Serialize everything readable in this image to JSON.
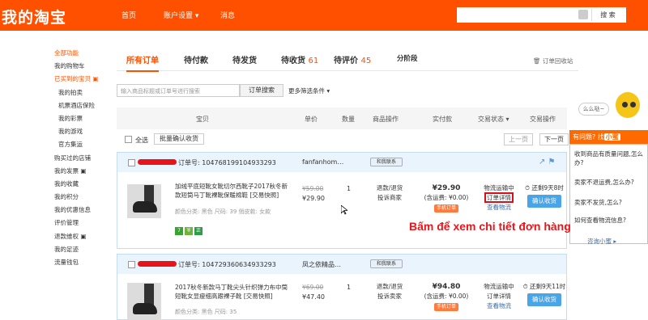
{
  "topbar": {
    "logo": "我的淘宝",
    "nav": [
      "首页",
      "账户设置 ▾",
      "消息"
    ],
    "search_btn": "搜 索"
  },
  "sidebar": {
    "items": [
      {
        "label": "全部功能",
        "style": "hl"
      },
      {
        "label": "我的购物车",
        "style": ""
      },
      {
        "label": "已买到的宝贝 ▣",
        "style": "hl"
      },
      {
        "label": "我的拍卖",
        "style": "sub"
      },
      {
        "label": "机票酒店保险",
        "style": "sub"
      },
      {
        "label": "我的彩票",
        "style": "sub"
      },
      {
        "label": "我的游戏",
        "style": "sub"
      },
      {
        "label": "官方集运",
        "style": "sub"
      },
      {
        "label": "购买过的店铺",
        "style": ""
      },
      {
        "label": "我的发票 ▣",
        "style": ""
      },
      {
        "label": "我的收藏",
        "style": ""
      },
      {
        "label": "我的积分",
        "style": ""
      },
      {
        "label": "我的优惠信息",
        "style": ""
      },
      {
        "label": "评价管理",
        "style": ""
      },
      {
        "label": "退款维权 ▣",
        "style": ""
      },
      {
        "label": "我的足迹",
        "style": ""
      },
      {
        "label": "流量钱包",
        "style": ""
      }
    ]
  },
  "tabs": [
    {
      "label": "所有订单",
      "count": ""
    },
    {
      "label": "待付款",
      "count": ""
    },
    {
      "label": "待发货",
      "count": ""
    },
    {
      "label": "待收货",
      "count": "61"
    },
    {
      "label": "待评价",
      "count": "45"
    },
    {
      "label": "分阶段",
      "count": ""
    }
  ],
  "recycle": "🗑 订单回收站",
  "filter": {
    "placeholder": "输入商品标题或订单号进行搜索",
    "search_btn": "订单搜索",
    "more": "更多筛选条件 ▾"
  },
  "table_headers": [
    "宝贝",
    "单价",
    "数量",
    "商品操作",
    "实付款",
    "交易状态 ▾",
    "交易操作"
  ],
  "bar": {
    "select_all": "全选",
    "batch": "批量确认收货",
    "prev": "上一页",
    "next": "下一页"
  },
  "orders": [
    {
      "order_no": "订单号: 104768199104933293",
      "shop": "fanfanhom…",
      "contact": "和我联系",
      "title": "加绒平底短靴女靴切尔西靴子2017秋冬新款短筒马丁靴裸靴保暖棉鞋 [交易快照]",
      "attrs": "颜色分类: 黑色  尺码: 39  俏皮款: 女款",
      "old_price": "¥59.00",
      "price": "¥29.90",
      "qty": "1",
      "ops": [
        "退款/退货",
        "投诉商家"
      ],
      "total": "¥29.90",
      "shipping": "(含运费: ¥0.00)",
      "mobile": "手机订单",
      "status": "物流运输中",
      "detail": "订单详情",
      "logistics": "查看物流",
      "remaining": "⏱ 还剩9天8时",
      "confirm": "确认收货"
    },
    {
      "order_no": "订单号: 104729360634933293",
      "shop": "凤之依精品…",
      "contact": "和我联系",
      "title": "2017秋冬新款马丁靴尖头针织弹力布中筒短靴女显瘦细高跟裸子靴 [交易快照]",
      "attrs": "颜色分类: 黑色  尺码: 35",
      "old_price": "¥69.00",
      "price": "¥47.40",
      "qty": "1",
      "ops": [
        "退款/退货",
        "投诉卖家"
      ],
      "total": "¥94.80",
      "shipping": "(含运费: ¥0.00)",
      "mobile": "手机订单",
      "status": "物流运输中",
      "detail": "订单详情",
      "logistics": "查看物流",
      "remaining": "⏱ 还剩9天11时",
      "confirm": "确认收货"
    }
  ],
  "help": {
    "ask": "么么哒~",
    "bar_prefix": "有问题? 找",
    "bar_name": "小蜜",
    "questions": [
      "收到商品有质量问题,怎么办?",
      "卖家不退运费,怎么办?",
      "卖家不发货,怎么?",
      "如何查看物流信息?"
    ],
    "more": "咨询小蜜 ▸"
  },
  "callout": "Bấm để xem chi tiết đơn hàng",
  "colors": {
    "brand": "#ff5000",
    "callout": "#e8161c",
    "button": "#4aa4e8"
  }
}
